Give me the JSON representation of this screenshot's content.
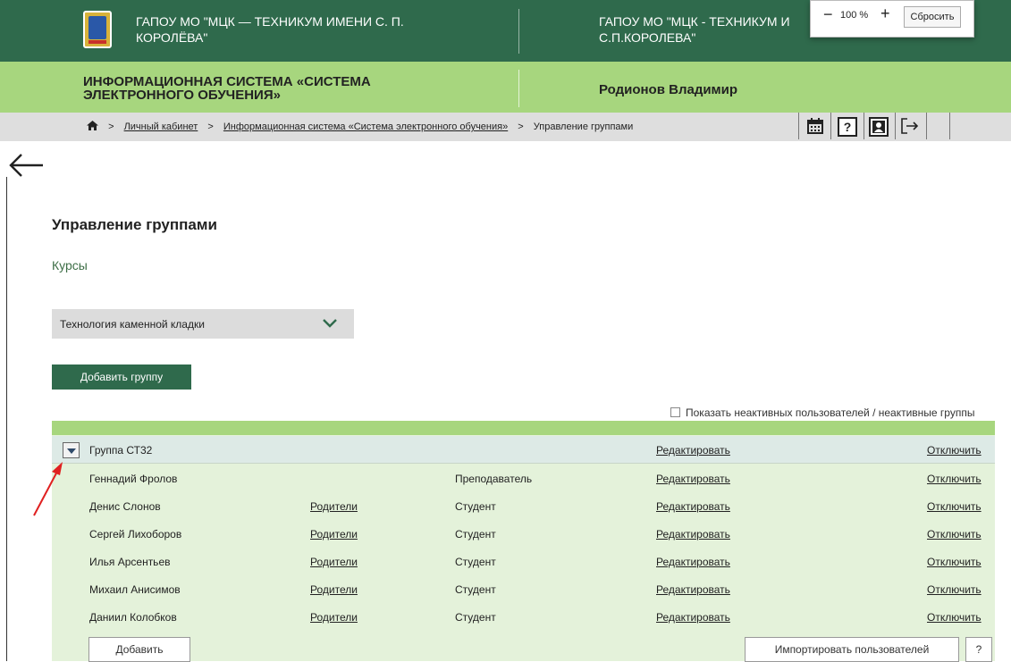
{
  "header": {
    "org_left_line1": "ГАПОУ МО \"МЦК — ТЕХНИКУМ ИМЕНИ С. П.",
    "org_left_line2": "КОРОЛЁВА\"",
    "org_right_line1": "ГАПОУ МО \"МЦК - ТЕХНИКУМ И",
    "org_right_line2": "С.П.КОРОЛЕВА\"",
    "system_line1": "ИНФОРМАЦИОННАЯ СИСТЕМА «СИСТЕМА",
    "system_line2": "ЭЛЕКТРОННОГО ОБУЧЕНИЯ»",
    "user_name": "Родионов Владимир"
  },
  "zoom": {
    "minus": "−",
    "value": "100 %",
    "plus": "+",
    "reset": "Сбросить"
  },
  "breadcrumb": {
    "sep": ">",
    "items": [
      "Личный кабинет",
      "Информационная система «Система электронного обучения»",
      "Управление группами"
    ]
  },
  "page": {
    "title": "Управление группами",
    "courses_label": "Курсы",
    "course_selected": "Технология каменной кладки",
    "add_group": "Добавить группу",
    "show_inactive": "Показать неактивных пользователей / неактивные группы"
  },
  "group": {
    "name": "Группа СТ32",
    "edit": "Редактировать",
    "disable": "Отключить",
    "members": [
      {
        "name": "Геннадий Фролов",
        "parents": "",
        "role": "Преподаватель"
      },
      {
        "name": "Денис Слонов",
        "parents": "Родители",
        "role": "Студент"
      },
      {
        "name": "Сергей Лихоборов",
        "parents": "Родители",
        "role": "Студент"
      },
      {
        "name": "Илья Арсентьев",
        "parents": "Родители",
        "role": "Студент"
      },
      {
        "name": "Михаил Анисимов",
        "parents": "Родители",
        "role": "Студент"
      },
      {
        "name": "Даниил Колобков",
        "parents": "Родители",
        "role": "Студент"
      }
    ],
    "member_edit": "Редактировать",
    "member_disable": "Отключить",
    "add": "Добавить",
    "import": "Импортировать пользователей",
    "help": "?"
  },
  "icons": [
    "home-icon",
    "calendar-icon",
    "help-icon",
    "profile-icon",
    "logout-icon",
    "back-arrow-icon",
    "chevron-down-icon",
    "triangle-down-icon"
  ],
  "colors": {
    "dark_green": "#2f6a4c",
    "light_green": "#a7d67e",
    "row_green": "#e4f2da",
    "annotation_arrow": "#e02020"
  }
}
